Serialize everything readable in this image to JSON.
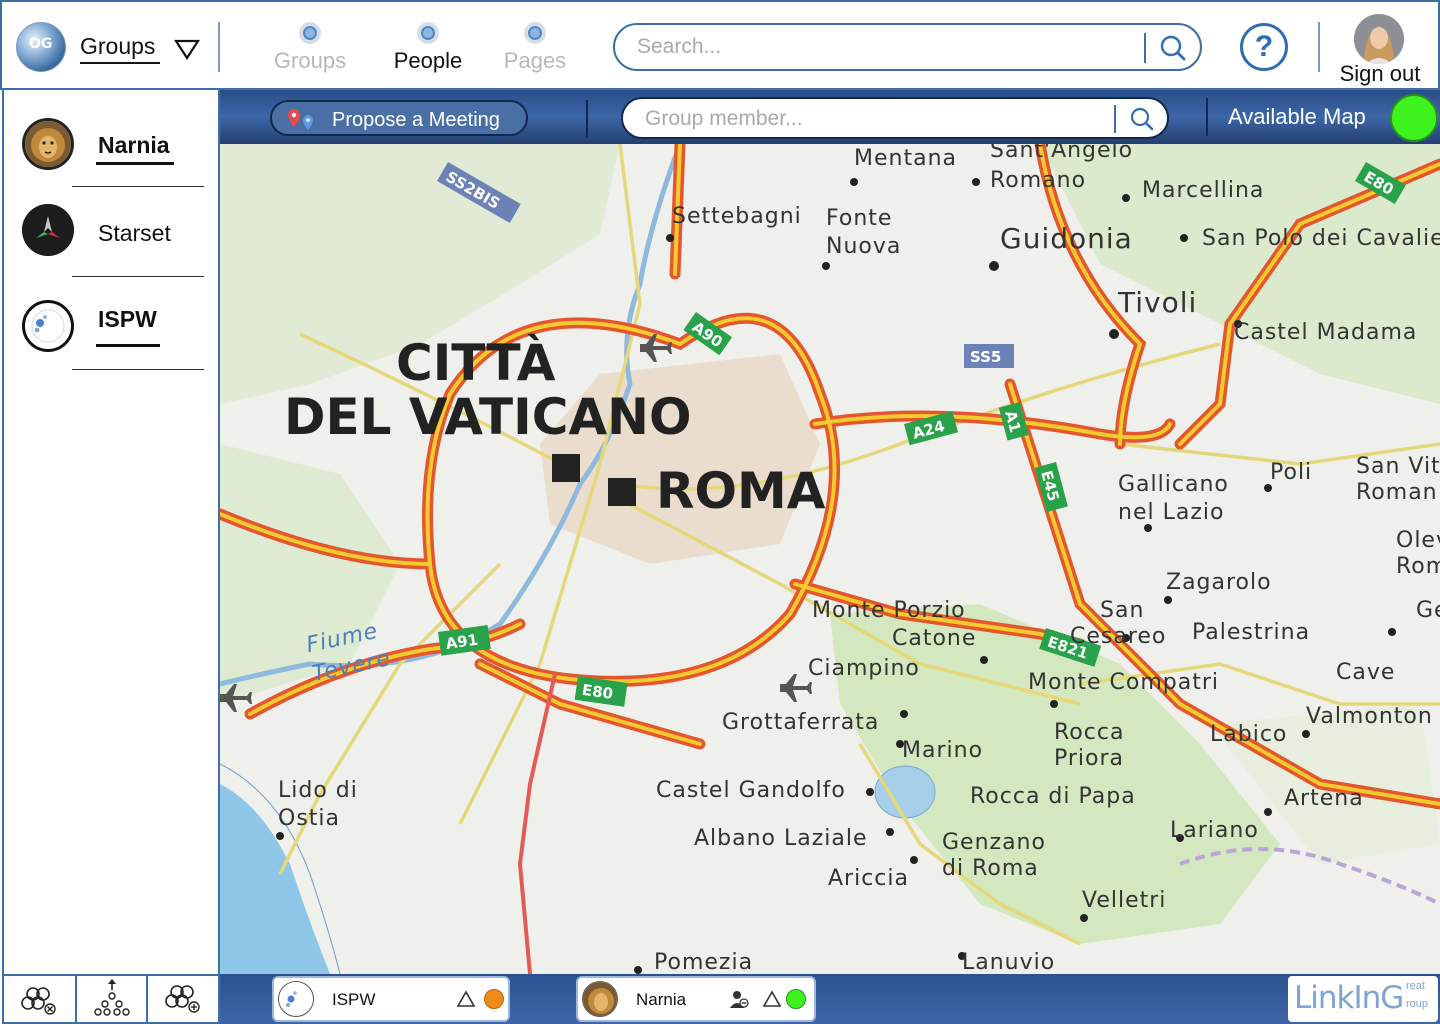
{
  "header": {
    "logo_text": "OG",
    "group_selector_label": "Groups",
    "mode_tabs": [
      {
        "label": "Groups",
        "active": false
      },
      {
        "label": "People",
        "active": true
      },
      {
        "label": "Pages",
        "active": false
      }
    ],
    "search_placeholder": "Search...",
    "help_label": "?",
    "sign_out_label": "Sign out"
  },
  "sidebar": {
    "groups": [
      {
        "name": "Narnia",
        "selected": true,
        "underlined": true
      },
      {
        "name": "Starset",
        "selected": false,
        "underlined": false
      },
      {
        "name": "ISPW",
        "selected": false,
        "underlined": true
      }
    ],
    "bottom_buttons": [
      {
        "icon": "leave-group-icon"
      },
      {
        "icon": "group-hierarchy-icon"
      },
      {
        "icon": "add-group-icon"
      }
    ]
  },
  "map_toolbar": {
    "propose_meeting_label": "Propose a Meeting",
    "member_search_placeholder": "Group member...",
    "available_map_label": "Available Map",
    "available_map_color": "#3cf320"
  },
  "map": {
    "places_major": [
      "CITTÀ",
      "DEL VATICANO",
      "ROMA"
    ],
    "places_medium": [
      "Guidonia",
      "Tivoli"
    ],
    "places": [
      "Mentana",
      "Sant'Angelo",
      "Romano",
      "Marcellina",
      "Settebagni",
      "Fonte",
      "Nuova",
      "San Polo dei Cavalie",
      "Castel Madama",
      "Gallicano",
      "nel Lazio",
      "Poli",
      "San Vit",
      "Roman",
      "Olev",
      "Rom",
      "Zagarolo",
      "Monte Porzio",
      "Catone",
      "San",
      "Cesareo",
      "Palestrina",
      "Gen",
      "Ciampino",
      "Monte Compatri",
      "Cave",
      "Grottaferrata",
      "Rocca",
      "Priora",
      "Labico",
      "Valmonton",
      "Marino",
      "Lido di",
      "Ostia",
      "Castel Gandolfo",
      "Rocca di Papa",
      "Artena",
      "Albano Laziale",
      "Genzano",
      "di Roma",
      "Lariano",
      "Ariccia",
      "Velletri",
      "Lanuvio",
      "Pomezia"
    ],
    "river": [
      "Fiume",
      "Tevere"
    ],
    "road_shields": [
      "SS2BIS",
      "A90",
      "SS5",
      "A24",
      "A1",
      "E45",
      "A91",
      "E80",
      "E821",
      "E80"
    ]
  },
  "dock": {
    "chats": [
      {
        "name": "ISPW",
        "status_color": "#ef8a1a"
      },
      {
        "name": "Narnia",
        "status_color": "#3cf320"
      }
    ],
    "brand_word": "LinkInG",
    "brand_sub1": "reat",
    "brand_sub2": "roup"
  }
}
